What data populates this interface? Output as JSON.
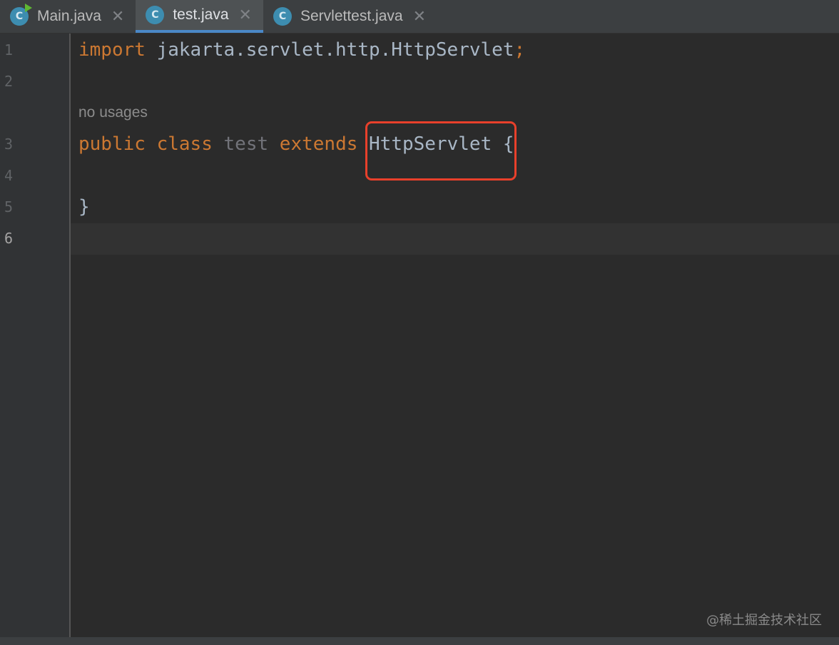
{
  "tabs": [
    {
      "label": "Main.java",
      "icon_letter": "C",
      "icon": "java-class-icon",
      "has_run_badge": true,
      "active": false
    },
    {
      "label": "test.java",
      "icon_letter": "C",
      "icon": "java-class-icon",
      "has_run_badge": false,
      "active": true
    },
    {
      "label": "Servlettest.java",
      "icon_letter": "C",
      "icon": "java-class-icon",
      "has_run_badge": false,
      "active": false
    }
  ],
  "close_glyph": "✕",
  "gutter": {
    "line_numbers": [
      "1",
      "2",
      "3",
      "4",
      "5",
      "6"
    ],
    "current_line": "6"
  },
  "code": {
    "line1": {
      "keyword": "import",
      "rest": " jakarta.servlet.http.HttpServlet",
      "semicolon": ";"
    },
    "hint": "no usages",
    "line3": {
      "kw_public": "public",
      "kw_class": "class",
      "class_name": "test",
      "kw_extends": "extends",
      "superclass": "HttpServlet",
      "brace": "{"
    },
    "line5": "}"
  },
  "annotation": {
    "color": "#e8402b",
    "target": "HttpServlet"
  },
  "watermark": "@稀土掘金技术社区",
  "colors": {
    "background": "#2b2b2b",
    "gutter": "#313335",
    "keyword": "#cc7832",
    "identifier": "#a9b7c6",
    "unused": "#72737a",
    "active_tab_underline": "#4a88c7",
    "class_icon": "#3d8db0",
    "run_badge": "#5fb832"
  }
}
